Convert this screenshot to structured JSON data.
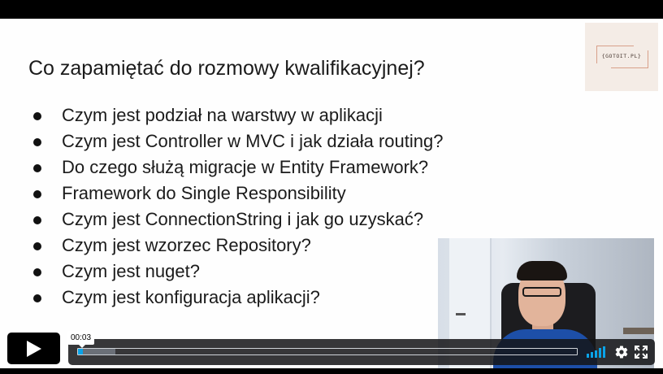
{
  "slide": {
    "title": "Co zapamiętać do rozmowy kwalifikacyjnej?",
    "logo_text": "{GOTOIT.PL}",
    "bullets": [
      "Czym jest podział na warstwy w aplikacji",
      "Czym jest Controller w MVC i jak działa routing?",
      "Do czego służą migracje w Entity Framework?",
      "Framework do Single Responsibility",
      "Czym jest ConnectionString i jak go uzyskać?",
      "Czym jest wzorzec Repository?",
      "Czym jest nuget?",
      "Czym jest konfiguracja aplikacji?"
    ]
  },
  "player": {
    "current_time": "00:03",
    "progress_fraction": 0.01,
    "buffered_fraction": 0.075,
    "accent_color": "#0aa3e8",
    "icons": [
      "play-icon",
      "volume-icon",
      "settings-gear-icon",
      "fullscreen-icon"
    ]
  }
}
